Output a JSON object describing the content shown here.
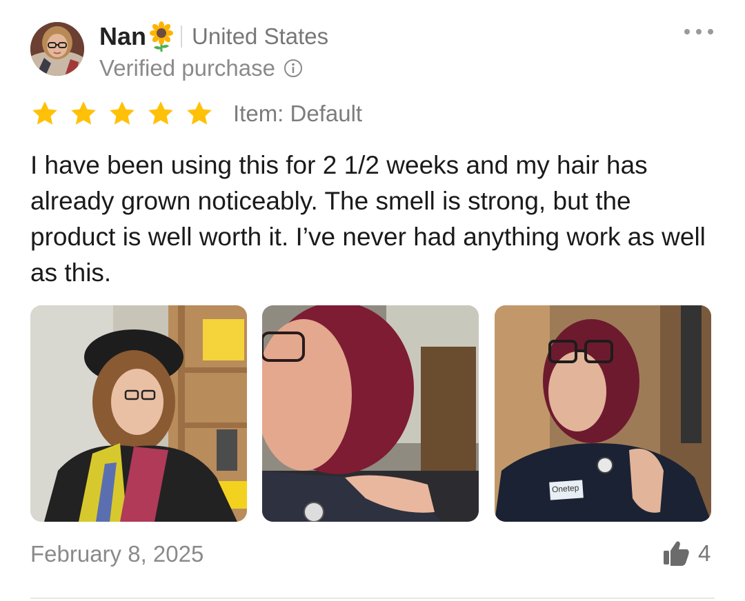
{
  "review": {
    "author": "Nan",
    "country": "United States",
    "verified_label": "Verified purchase",
    "rating": 5,
    "item_label": "Item: Default",
    "text": "I have been using this for 2 1/2 weeks and my hair has already grown noticeably. The smell is strong, but the product is well worth it. I’ve never had anything work as well as this.",
    "date": "February 8, 2025",
    "like_count": "4",
    "photos": [
      {
        "name": "review-photo-1"
      },
      {
        "name": "review-photo-2"
      },
      {
        "name": "review-photo-3",
        "badge_text": "Onetep"
      }
    ]
  },
  "icons": {
    "flower": "sunflower-emoji",
    "info": "info-icon",
    "more": "more-options-icon",
    "star": "star-icon",
    "like": "thumbs-up-icon"
  },
  "colors": {
    "star": "#FFC107",
    "text_muted": "#8a8a8a",
    "text_primary": "#1a1a1a"
  }
}
